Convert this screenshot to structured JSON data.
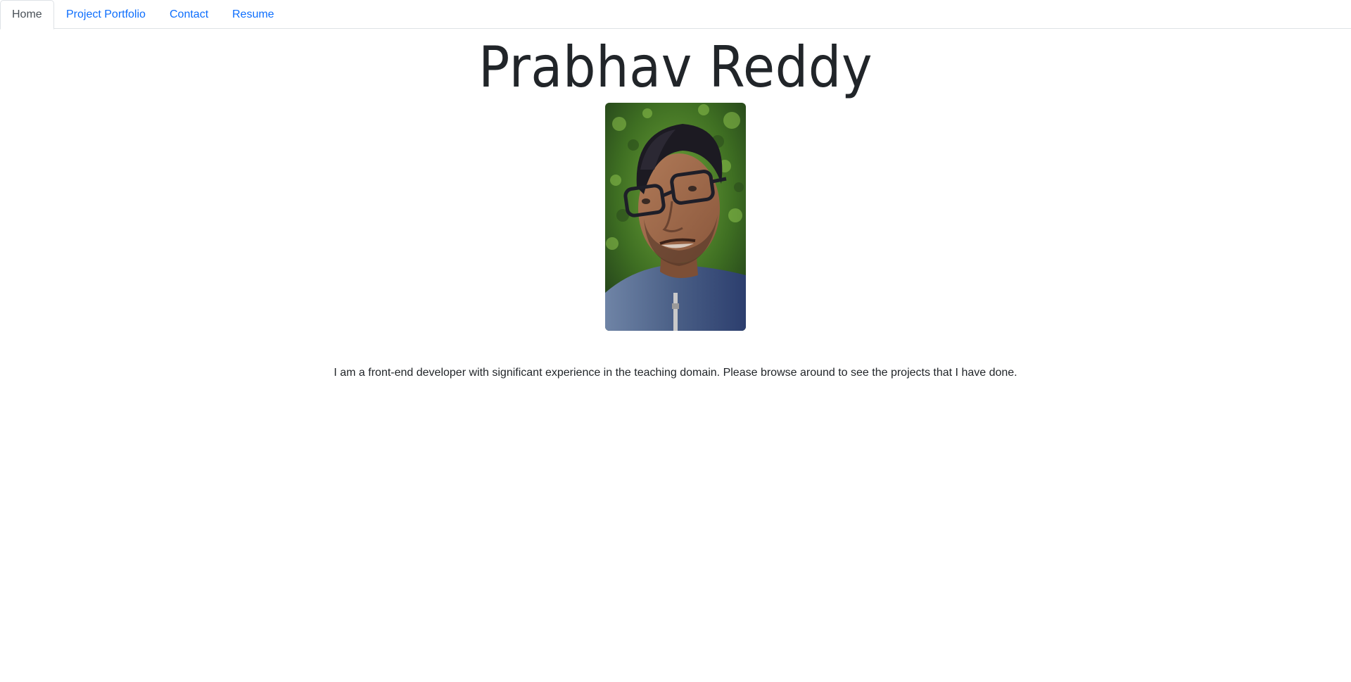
{
  "nav": {
    "tabs": [
      {
        "label": "Home",
        "active": true
      },
      {
        "label": "Project Portfolio",
        "active": false
      },
      {
        "label": "Contact",
        "active": false
      },
      {
        "label": "Resume",
        "active": false
      }
    ]
  },
  "header": {
    "title": "Prabhav Reddy"
  },
  "profile": {
    "photo_alt": "profile photo"
  },
  "main": {
    "bio": "I am a front-end developer with significant experience in the teaching domain. Please browse around to see the projects that I have done."
  },
  "colors": {
    "link": "#0d6efd",
    "active_tab_text": "#495057",
    "border": "#dee2e6",
    "text": "#212529"
  }
}
